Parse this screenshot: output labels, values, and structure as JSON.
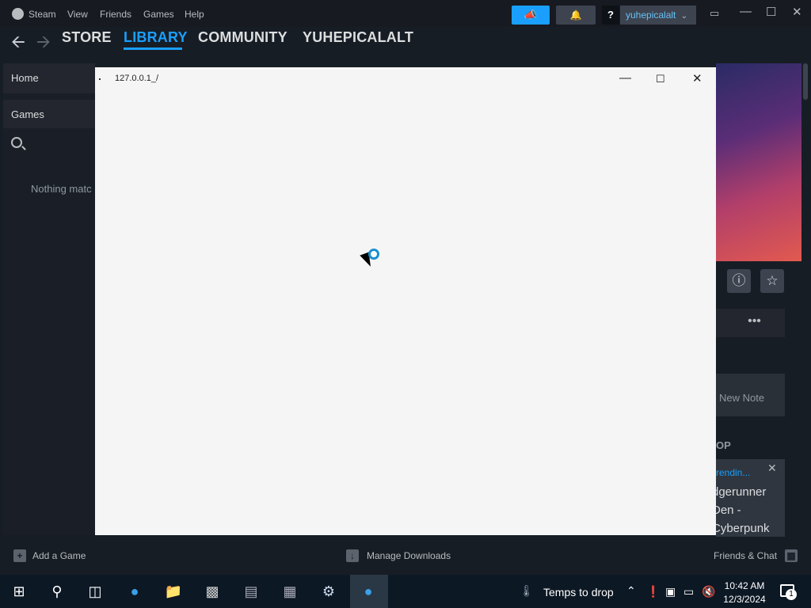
{
  "steam": {
    "menu": [
      "Steam",
      "View",
      "Friends",
      "Games",
      "Help"
    ],
    "username": "yuhepicalalt",
    "help_label": "?",
    "nav": [
      "STORE",
      "LIBRARY",
      "COMMUNITY",
      "YUHEPICALALT"
    ],
    "active_nav": "LIBRARY",
    "sidebar": {
      "home": "Home",
      "games": "Games",
      "empty_message": "Nothing matc"
    },
    "right_panel": {
      "new_note": "New Note",
      "section_label": "OP",
      "news_tag": "rendin...",
      "news_title": "dgerunner Den - Cyberpunk",
      "more": "•••"
    },
    "bottom": {
      "add_game": "Add a Game",
      "manage_downloads": "Manage Downloads",
      "friends_chat": "Friends & Chat"
    },
    "accent_color": "#1a9fff"
  },
  "popup": {
    "title": "127.0.0.1_/"
  },
  "taskbar": {
    "tray_text": "Temps to drop",
    "time": "10:42 AM",
    "date": "12/3/2024",
    "notification_count": "1"
  }
}
